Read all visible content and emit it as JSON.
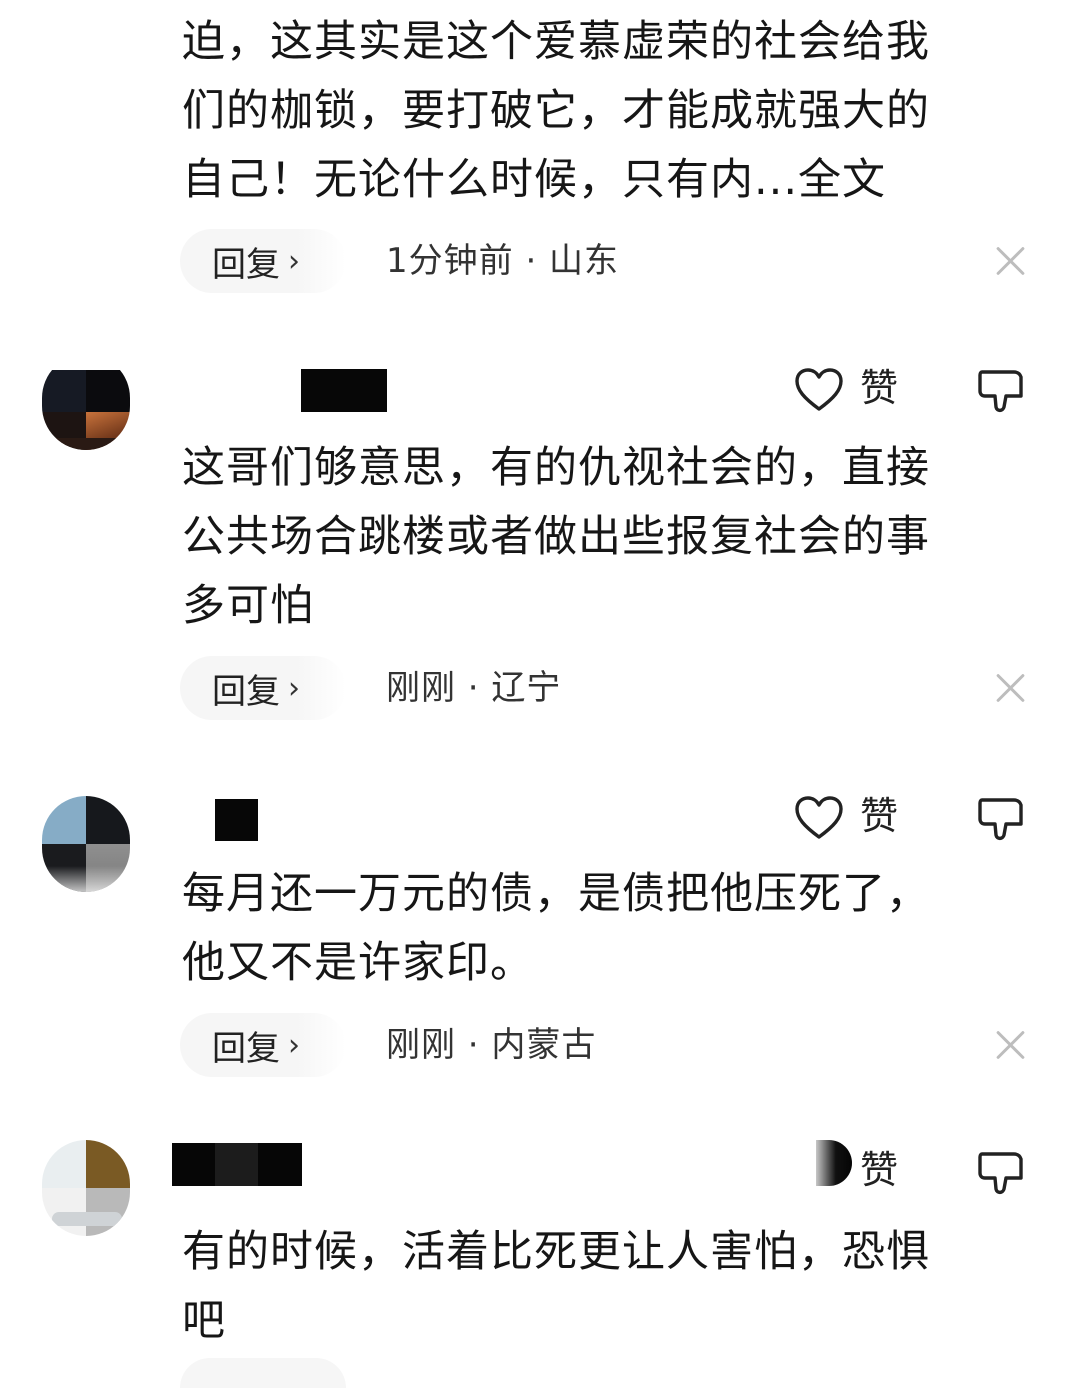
{
  "comments": [
    {
      "text": "迫，这其实是这个爱慕虚荣的社会给我\n们的枷锁，要打破它，才能成就强大的\n自己！无论什么时候，只有内...全文",
      "reply_label": "回复",
      "meta": "1分钟前 · 山东"
    },
    {
      "like_label": "赞",
      "text": "这哥们够意思，有的仇视社会的，直接\n公共场合跳楼或者做出些报复社会的事\n多可怕",
      "reply_label": "回复",
      "meta": "刚刚 · 辽宁"
    },
    {
      "like_label": "赞",
      "text": "每月还一万元的债，是债把他压死了，\n他又不是许家印。",
      "reply_label": "回复",
      "meta": "刚刚 · 内蒙古"
    },
    {
      "like_label": "赞",
      "text": "有的时候，活着比死更让人害怕，恐惧\n吧"
    }
  ],
  "icons": {
    "reply_chevron": "chevron-right-icon",
    "close": "close-icon",
    "like": "heart-outline-icon",
    "dislike": "thumbs-down-icon"
  },
  "colors": {
    "text": "#161616",
    "meta": "#333333",
    "pill_bg": "#f6f6f6",
    "close_icon": "#bdbdbd"
  }
}
